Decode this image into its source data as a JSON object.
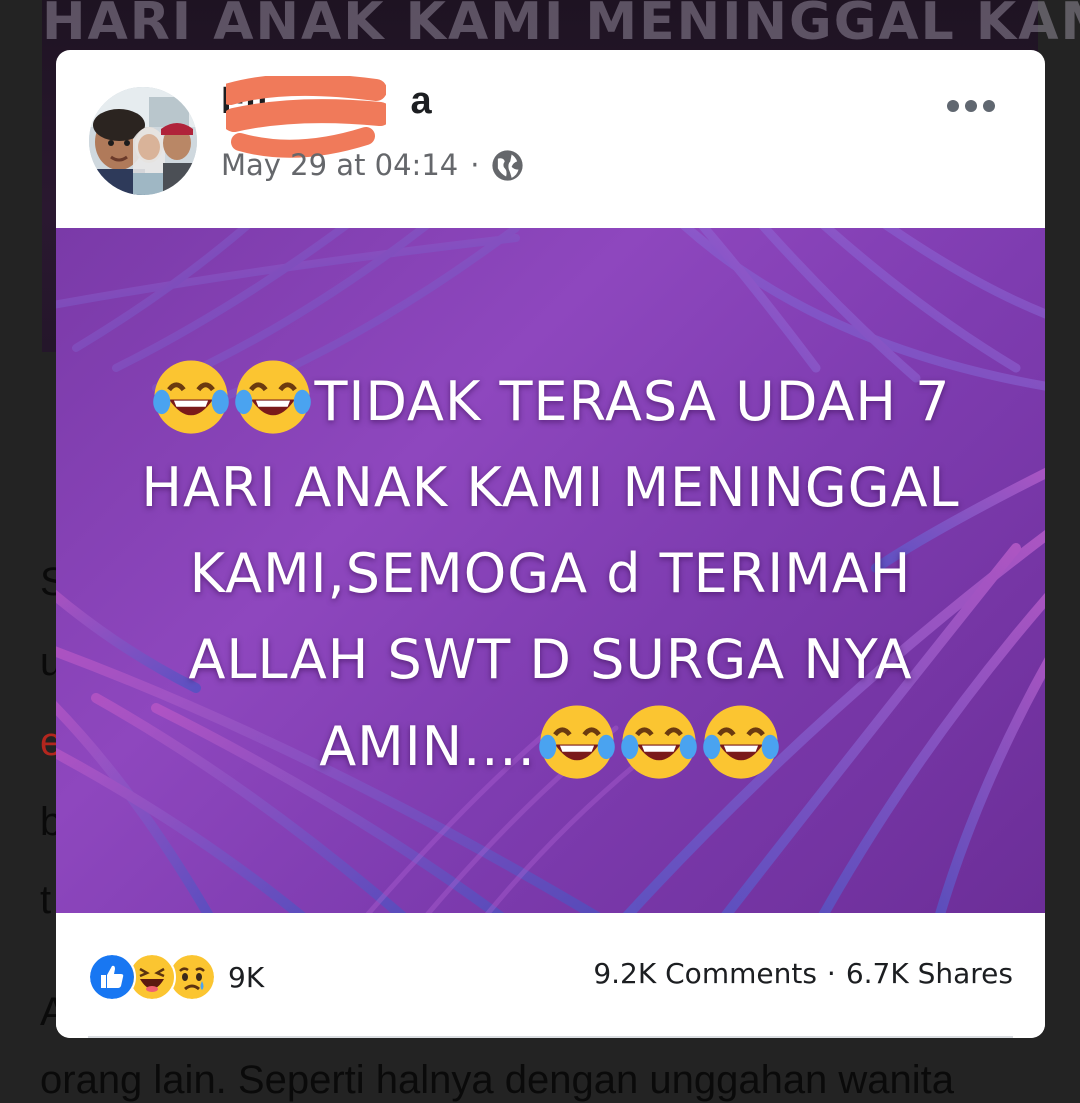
{
  "background": {
    "banner_text": "HARI ANAK KAMI MENINGGAL KAMI SEMOGA d TERIMAH",
    "letters": [
      "S",
      "u",
      "e",
      "b",
      "t",
      "A"
    ],
    "bottom_text": "orang lain. Seperti halnya dengan unggahan wanita"
  },
  "post": {
    "author_name_prefix": "Fit",
    "author_name_suffix": "a",
    "timestamp": "May 29 at 04:14",
    "separator": "·",
    "audience_icon": "globe-icon",
    "more_icon": "more-options-icon",
    "image_text": {
      "line1": "TIDAK TERASA UDAH 7",
      "line2": "HARI ANAK KAMI MENINGGAL",
      "line3": "KAMI,SEMOGA d TERIMAH",
      "line4": "ALLAH SWT D SURGA NYA",
      "line5": "AMIN...."
    },
    "emoji_name": "face-with-tears-of-joy"
  },
  "footer": {
    "reaction_icons": [
      "like-icon",
      "haha-icon",
      "sad-icon"
    ],
    "reaction_count": "9K",
    "comments": "9.2K Comments",
    "separator": "·",
    "shares": "6.7K Shares"
  },
  "colors": {
    "redaction": "#f07a5a",
    "image_purple": "#8e47be",
    "like_blue": "#1877f2",
    "emoji_yellow": "#fbc531"
  }
}
